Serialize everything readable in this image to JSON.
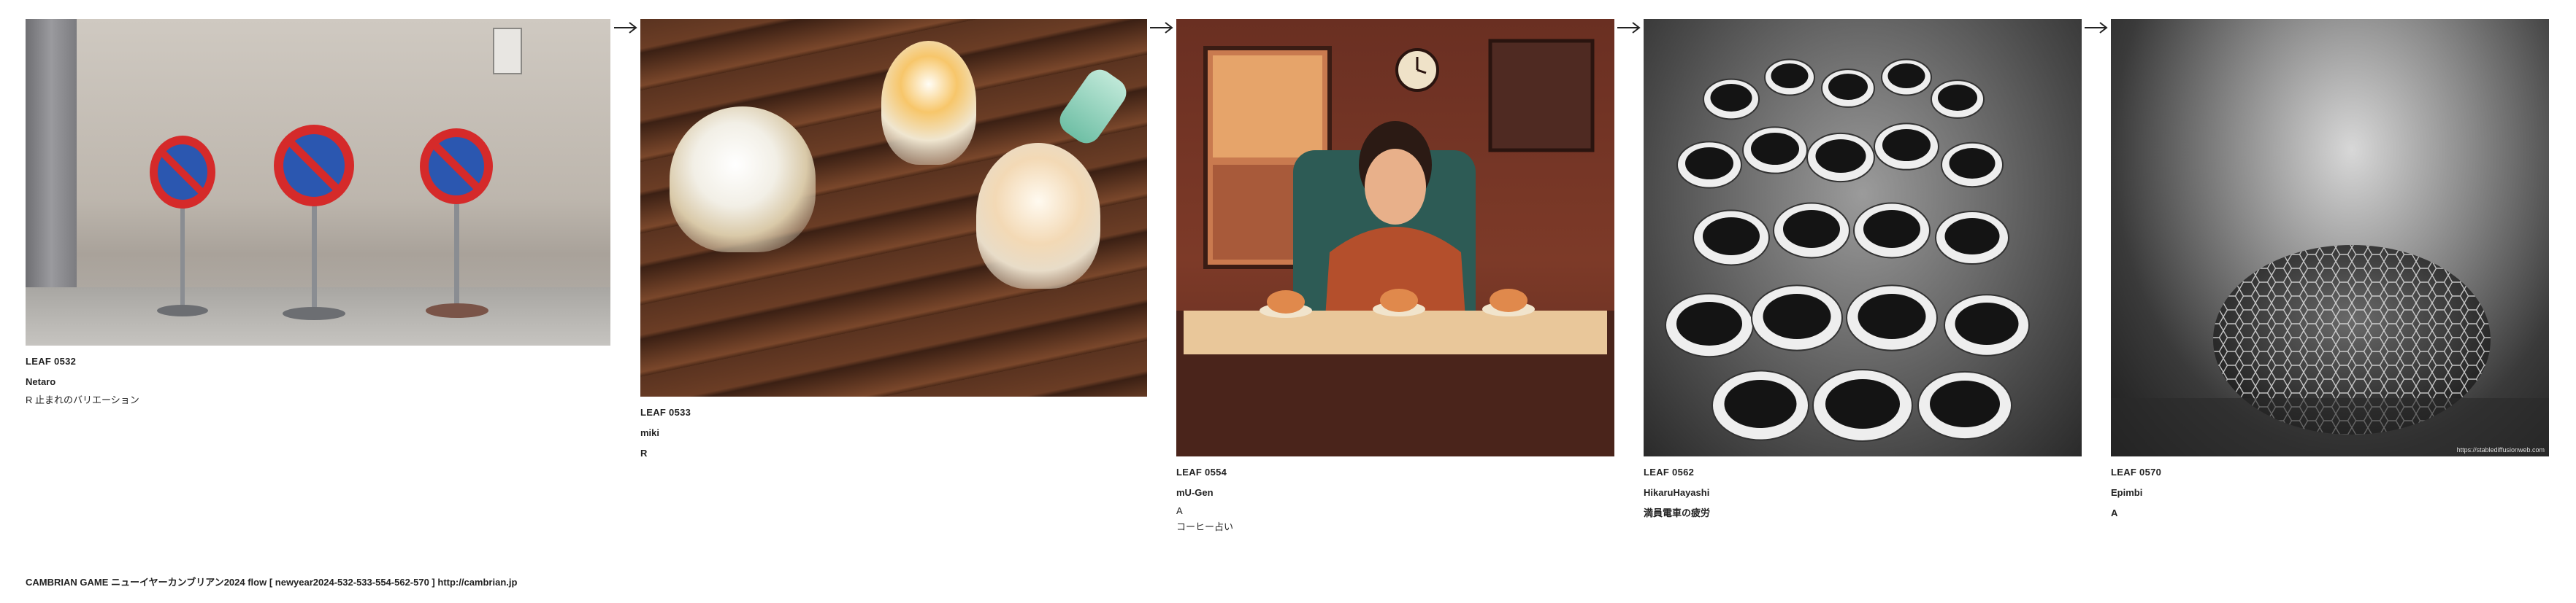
{
  "leaves": [
    {
      "code": "LEAF 0532",
      "author": "Netaro",
      "meta": "R",
      "title": "止まれのバリエーション"
    },
    {
      "code": "LEAF 0533",
      "author": "miki",
      "meta": "R"
    },
    {
      "code": "LEAF 0554",
      "author": "mU-Gen",
      "meta": "A",
      "title": "コーヒー占い"
    },
    {
      "code": "LEAF 0562",
      "author": "HikaruHayashi",
      "meta": "満員電車の疲労"
    },
    {
      "code": "LEAF 0570",
      "author": "Epimbi",
      "meta": "A"
    }
  ],
  "leaf5_url": "https://stablediffusionweb.com",
  "footer": "CAMBRIAN GAME  ニューイヤーカンブリアン2024  flow [ newyear2024-532-533-554-562-570 ]    http://cambrian.jp"
}
